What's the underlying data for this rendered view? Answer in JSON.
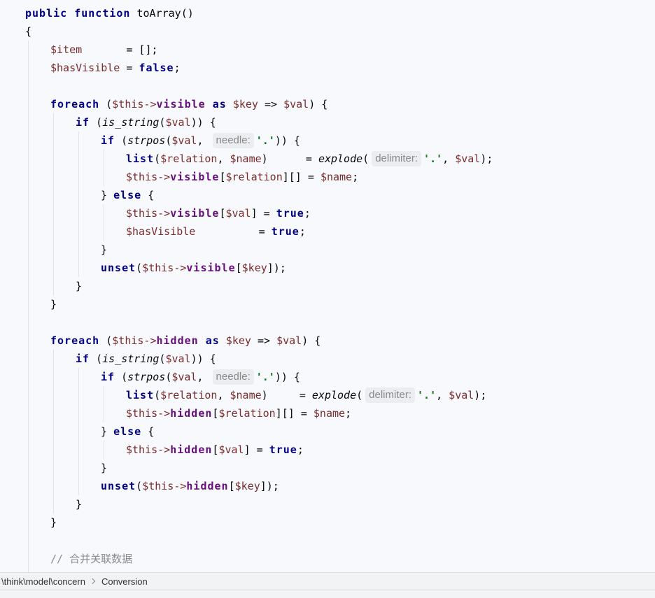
{
  "editor": {
    "lines": [
      {
        "indent": 0,
        "tokens": [
          {
            "kw": "public"
          },
          {
            "kw": " function"
          },
          {
            "fn_decl": " toArray"
          },
          {
            "txt": "()"
          }
        ]
      },
      {
        "indent": 0,
        "tokens": [
          {
            "txt": "{"
          }
        ]
      },
      {
        "indent": 1,
        "tokens": [
          {
            "var": "$item"
          },
          {
            "txt": "       = [];"
          }
        ]
      },
      {
        "indent": 1,
        "tokens": [
          {
            "var": "$hasVisible"
          },
          {
            "txt": " = "
          },
          {
            "kw": "false"
          },
          {
            "txt": ";"
          }
        ]
      },
      {
        "indent": 0,
        "tokens": []
      },
      {
        "indent": 1,
        "tokens": [
          {
            "kw": "foreach"
          },
          {
            "txt": " ("
          },
          {
            "var": "$this->"
          },
          {
            "field": "visible"
          },
          {
            "kw": " as"
          },
          {
            "var": " $key"
          },
          {
            "txt": " => "
          },
          {
            "var": "$val"
          },
          {
            "txt": ") {"
          }
        ]
      },
      {
        "indent": 2,
        "tokens": [
          {
            "kw": "if"
          },
          {
            "txt": " ("
          },
          {
            "call": "is_string"
          },
          {
            "txt": "("
          },
          {
            "var": "$val"
          },
          {
            "txt": ")) {"
          }
        ]
      },
      {
        "indent": 3,
        "tokens": [
          {
            "kw": "if"
          },
          {
            "txt": " ("
          },
          {
            "call": "strpos"
          },
          {
            "txt": "("
          },
          {
            "var": "$val"
          },
          {
            "txt": ", "
          },
          {
            "hint": "needle:"
          },
          {
            "str": "'.'"
          },
          {
            "txt": ")) {"
          }
        ]
      },
      {
        "indent": 4,
        "tokens": [
          {
            "kw": "list"
          },
          {
            "txt": "("
          },
          {
            "var": "$relation"
          },
          {
            "txt": ", "
          },
          {
            "var": "$name"
          },
          {
            "txt": ")      = "
          },
          {
            "call": "explode"
          },
          {
            "txt": "("
          },
          {
            "hint": "delimiter:"
          },
          {
            "str": "'.'"
          },
          {
            "txt": ", "
          },
          {
            "var": "$val"
          },
          {
            "txt": ");"
          }
        ]
      },
      {
        "indent": 4,
        "tokens": [
          {
            "var": "$this->"
          },
          {
            "field": "visible"
          },
          {
            "txt": "["
          },
          {
            "var": "$relation"
          },
          {
            "txt": "][] = "
          },
          {
            "var": "$name"
          },
          {
            "txt": ";"
          }
        ]
      },
      {
        "indent": 3,
        "tokens": [
          {
            "txt": "} "
          },
          {
            "kw": "else"
          },
          {
            "txt": " {"
          }
        ]
      },
      {
        "indent": 4,
        "tokens": [
          {
            "var": "$this->"
          },
          {
            "field": "visible"
          },
          {
            "txt": "["
          },
          {
            "var": "$val"
          },
          {
            "txt": "] = "
          },
          {
            "kw": "true"
          },
          {
            "txt": ";"
          }
        ]
      },
      {
        "indent": 4,
        "tokens": [
          {
            "var": "$hasVisible"
          },
          {
            "txt": "          = "
          },
          {
            "kw": "true"
          },
          {
            "txt": ";"
          }
        ]
      },
      {
        "indent": 3,
        "tokens": [
          {
            "txt": "}"
          }
        ]
      },
      {
        "indent": 3,
        "tokens": [
          {
            "kw": "unset"
          },
          {
            "txt": "("
          },
          {
            "var": "$this->"
          },
          {
            "field": "visible"
          },
          {
            "txt": "["
          },
          {
            "var": "$key"
          },
          {
            "txt": "]);"
          }
        ]
      },
      {
        "indent": 2,
        "tokens": [
          {
            "txt": "}"
          }
        ]
      },
      {
        "indent": 1,
        "tokens": [
          {
            "txt": "}"
          }
        ]
      },
      {
        "indent": 0,
        "tokens": []
      },
      {
        "indent": 1,
        "tokens": [
          {
            "kw": "foreach"
          },
          {
            "txt": " ("
          },
          {
            "var": "$this->"
          },
          {
            "field": "hidden"
          },
          {
            "kw": " as"
          },
          {
            "var": " $key"
          },
          {
            "txt": " => "
          },
          {
            "var": "$val"
          },
          {
            "txt": ") {"
          }
        ]
      },
      {
        "indent": 2,
        "tokens": [
          {
            "kw": "if"
          },
          {
            "txt": " ("
          },
          {
            "call": "is_string"
          },
          {
            "txt": "("
          },
          {
            "var": "$val"
          },
          {
            "txt": ")) {"
          }
        ]
      },
      {
        "indent": 3,
        "tokens": [
          {
            "kw": "if"
          },
          {
            "txt": " ("
          },
          {
            "call": "strpos"
          },
          {
            "txt": "("
          },
          {
            "var": "$val"
          },
          {
            "txt": ", "
          },
          {
            "hint": "needle:"
          },
          {
            "str": "'.'"
          },
          {
            "txt": ")) {"
          }
        ]
      },
      {
        "indent": 4,
        "tokens": [
          {
            "kw": "list"
          },
          {
            "txt": "("
          },
          {
            "var": "$relation"
          },
          {
            "txt": ", "
          },
          {
            "var": "$name"
          },
          {
            "txt": ")     = "
          },
          {
            "call": "explode"
          },
          {
            "txt": "("
          },
          {
            "hint": "delimiter:"
          },
          {
            "str": "'.'"
          },
          {
            "txt": ", "
          },
          {
            "var": "$val"
          },
          {
            "txt": ");"
          }
        ]
      },
      {
        "indent": 4,
        "tokens": [
          {
            "var": "$this->"
          },
          {
            "field": "hidden"
          },
          {
            "txt": "["
          },
          {
            "var": "$relation"
          },
          {
            "txt": "][] = "
          },
          {
            "var": "$name"
          },
          {
            "txt": ";"
          }
        ]
      },
      {
        "indent": 3,
        "tokens": [
          {
            "txt": "} "
          },
          {
            "kw": "else"
          },
          {
            "txt": " {"
          }
        ]
      },
      {
        "indent": 4,
        "tokens": [
          {
            "var": "$this->"
          },
          {
            "field": "hidden"
          },
          {
            "txt": "["
          },
          {
            "var": "$val"
          },
          {
            "txt": "] = "
          },
          {
            "kw": "true"
          },
          {
            "txt": ";"
          }
        ]
      },
      {
        "indent": 3,
        "tokens": [
          {
            "txt": "}"
          }
        ]
      },
      {
        "indent": 3,
        "tokens": [
          {
            "kw": "unset"
          },
          {
            "txt": "("
          },
          {
            "var": "$this->"
          },
          {
            "field": "hidden"
          },
          {
            "txt": "["
          },
          {
            "var": "$key"
          },
          {
            "txt": "]);"
          }
        ]
      },
      {
        "indent": 2,
        "tokens": [
          {
            "txt": "}"
          }
        ]
      },
      {
        "indent": 1,
        "tokens": [
          {
            "txt": "}"
          }
        ]
      },
      {
        "indent": 0,
        "tokens": []
      },
      {
        "indent": 1,
        "tokens": [
          {
            "comment": "// 合并关联数据"
          }
        ]
      }
    ]
  },
  "breadcrumb": {
    "items": [
      "\\think\\model\\concern",
      "Conversion"
    ],
    "separator_icon": "chevron-right-icon"
  },
  "colors": {
    "background": "#f7f9fd",
    "text": "#080808",
    "keyword": "#000080",
    "variable": "#7a2b2b",
    "field": "#660e7a",
    "string": "#067d17",
    "comment": "#8c8c8c",
    "hint_text": "#8a8a8a",
    "hint_background": "#ebedf0",
    "indent_guide": "#e0e2e7",
    "breadcrumb_background": "#f2f3f5",
    "breadcrumb_text": "#303030"
  }
}
